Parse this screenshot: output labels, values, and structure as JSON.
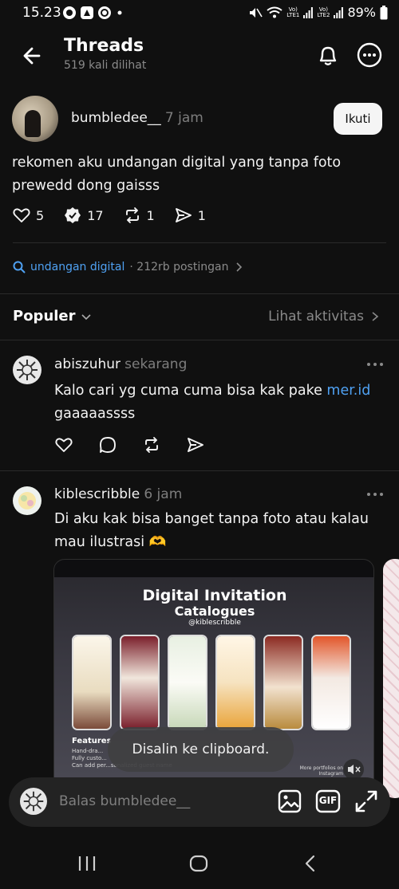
{
  "status_bar": {
    "time": "15.23",
    "battery": "89%",
    "sim1": "Vo) LTE1",
    "sim2": "Vo) LTE2"
  },
  "header": {
    "title": "Threads",
    "subtitle": "519 kali dilihat"
  },
  "post": {
    "username": "bumbledee__",
    "time": "7 jam",
    "follow_label": "Ikuti",
    "text": "rekomen aku undangan digital yang tanpa foto prewedd dong gaisss",
    "likes": "5",
    "reposts_quote": "17",
    "reposts": "1",
    "shares": "1"
  },
  "topic": {
    "name": "undangan digital",
    "count": "· 212rb postingan"
  },
  "sort": {
    "label": "Populer",
    "activity_link": "Lihat aktivitas"
  },
  "replies": [
    {
      "username": "abiszuhur",
      "time": "sekarang",
      "text_before": "Kalo cari yg cuma cuma bisa kak pake ",
      "link": "mer.id",
      "text_after": " gaaaaassss"
    },
    {
      "username": "kiblescribble",
      "time": "6 jam",
      "text": "Di aku kak bisa banget tanpa foto atau kalau mau ilustrasi 🫶",
      "image": {
        "title_line1": "Digital Invitation",
        "title_line2": "Catalogues",
        "handle": "@kiblescribble",
        "features_heading": "Features",
        "features": [
          "Hand-dra...",
          "Fully custo...",
          "Can add per...sonalized guest name"
        ],
        "footer_note": "More portfolios on Instagram"
      }
    }
  ],
  "toast": "Disalin ke clipboard.",
  "reply_bar": {
    "placeholder": "Balas bumbledee__",
    "gif_label": "GIF"
  },
  "icons": {
    "back": "arrow-left-icon",
    "bell": "bell-icon",
    "more": "more-horizontal-icon",
    "like": "heart-icon",
    "comment": "comment-icon",
    "repost": "repost-icon",
    "share": "send-icon",
    "search": "search-icon",
    "image": "image-icon",
    "expand": "expand-icon"
  },
  "colors": {
    "background": "#101010",
    "link": "#4fa1f2",
    "muted": "#7d7d7d"
  }
}
